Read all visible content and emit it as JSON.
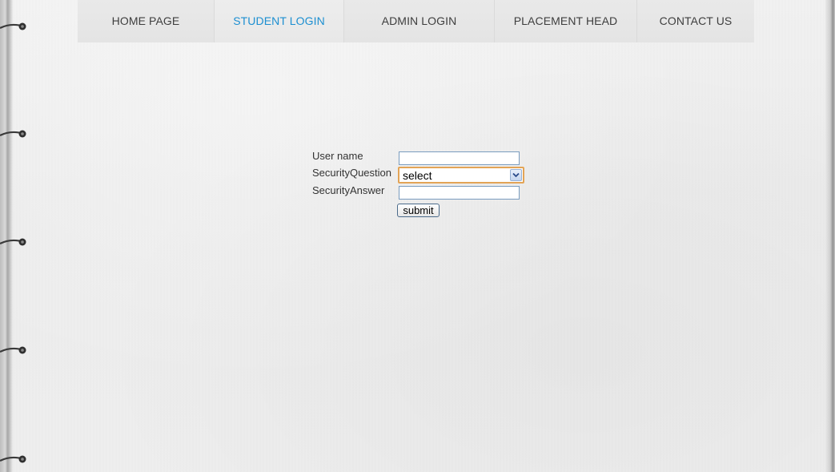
{
  "nav": {
    "items": [
      {
        "label": "HOME PAGE",
        "active": false
      },
      {
        "label": "STUDENT LOGIN",
        "active": true
      },
      {
        "label": "ADMIN LOGIN",
        "active": false
      },
      {
        "label": "PLACEMENT HEAD",
        "active": false
      },
      {
        "label": "CONTACT US",
        "active": false
      }
    ],
    "active_color": "#1c8fd1"
  },
  "form": {
    "username_label": "User name",
    "username_value": "",
    "security_question_label": "SecurityQuestion",
    "security_question_selected": "select",
    "security_answer_label": "SecurityAnswer",
    "security_answer_value": "",
    "submit_label": "submit"
  }
}
